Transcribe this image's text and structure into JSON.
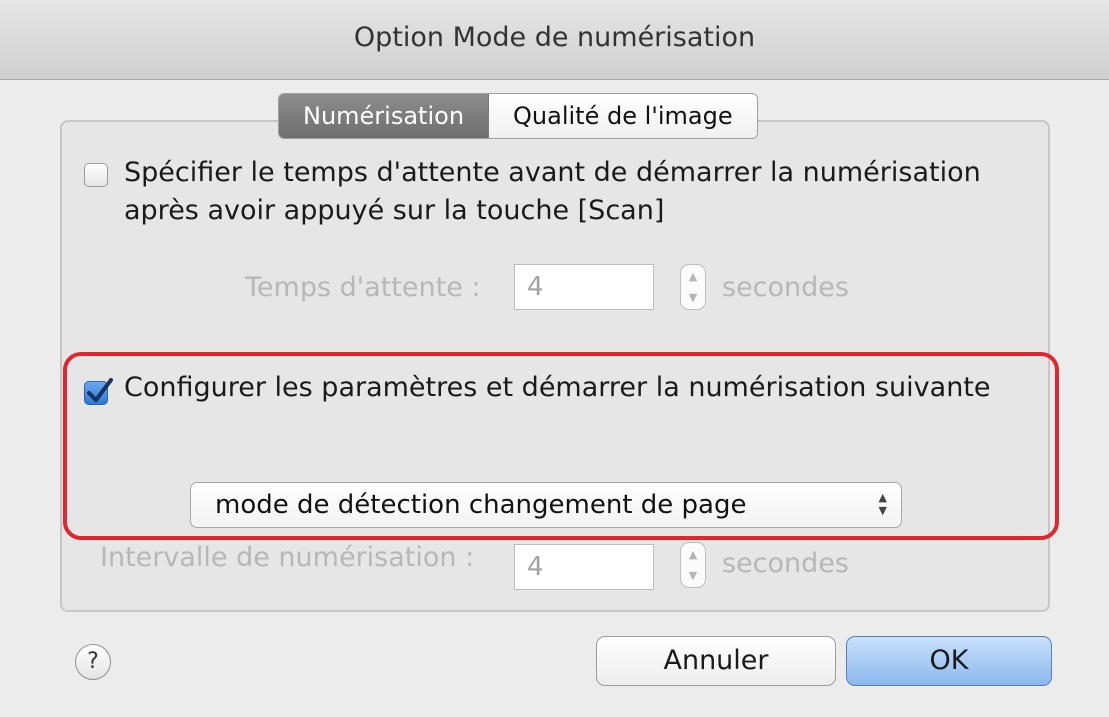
{
  "window": {
    "title": "Option Mode de numérisation"
  },
  "tabs": [
    {
      "label": "Numérisation",
      "active": true
    },
    {
      "label": "Qualité de l'image",
      "active": false
    }
  ],
  "wait_option": {
    "checkbox_label": "Spécifier le temps d'attente avant de démarrer la numérisation après avoir appuyé sur la touche [Scan]",
    "checked": false,
    "field_label": "Temps d'attente :",
    "value": "4",
    "unit": "secondes"
  },
  "next_scan_option": {
    "checkbox_label": "Configurer les paramètres et démarrer la numérisation suivante",
    "checked": true,
    "mode_select": {
      "selected": "mode de détection changement de page"
    }
  },
  "interval": {
    "label": "Intervalle de numérisation :",
    "value": "4",
    "unit": "secondes"
  },
  "buttons": {
    "help": "?",
    "cancel": "Annuler",
    "ok": "OK"
  },
  "colors": {
    "highlight": "#e0262f",
    "checkbox_checked": "#2f76d6",
    "default_button": "#8ab9ee"
  }
}
